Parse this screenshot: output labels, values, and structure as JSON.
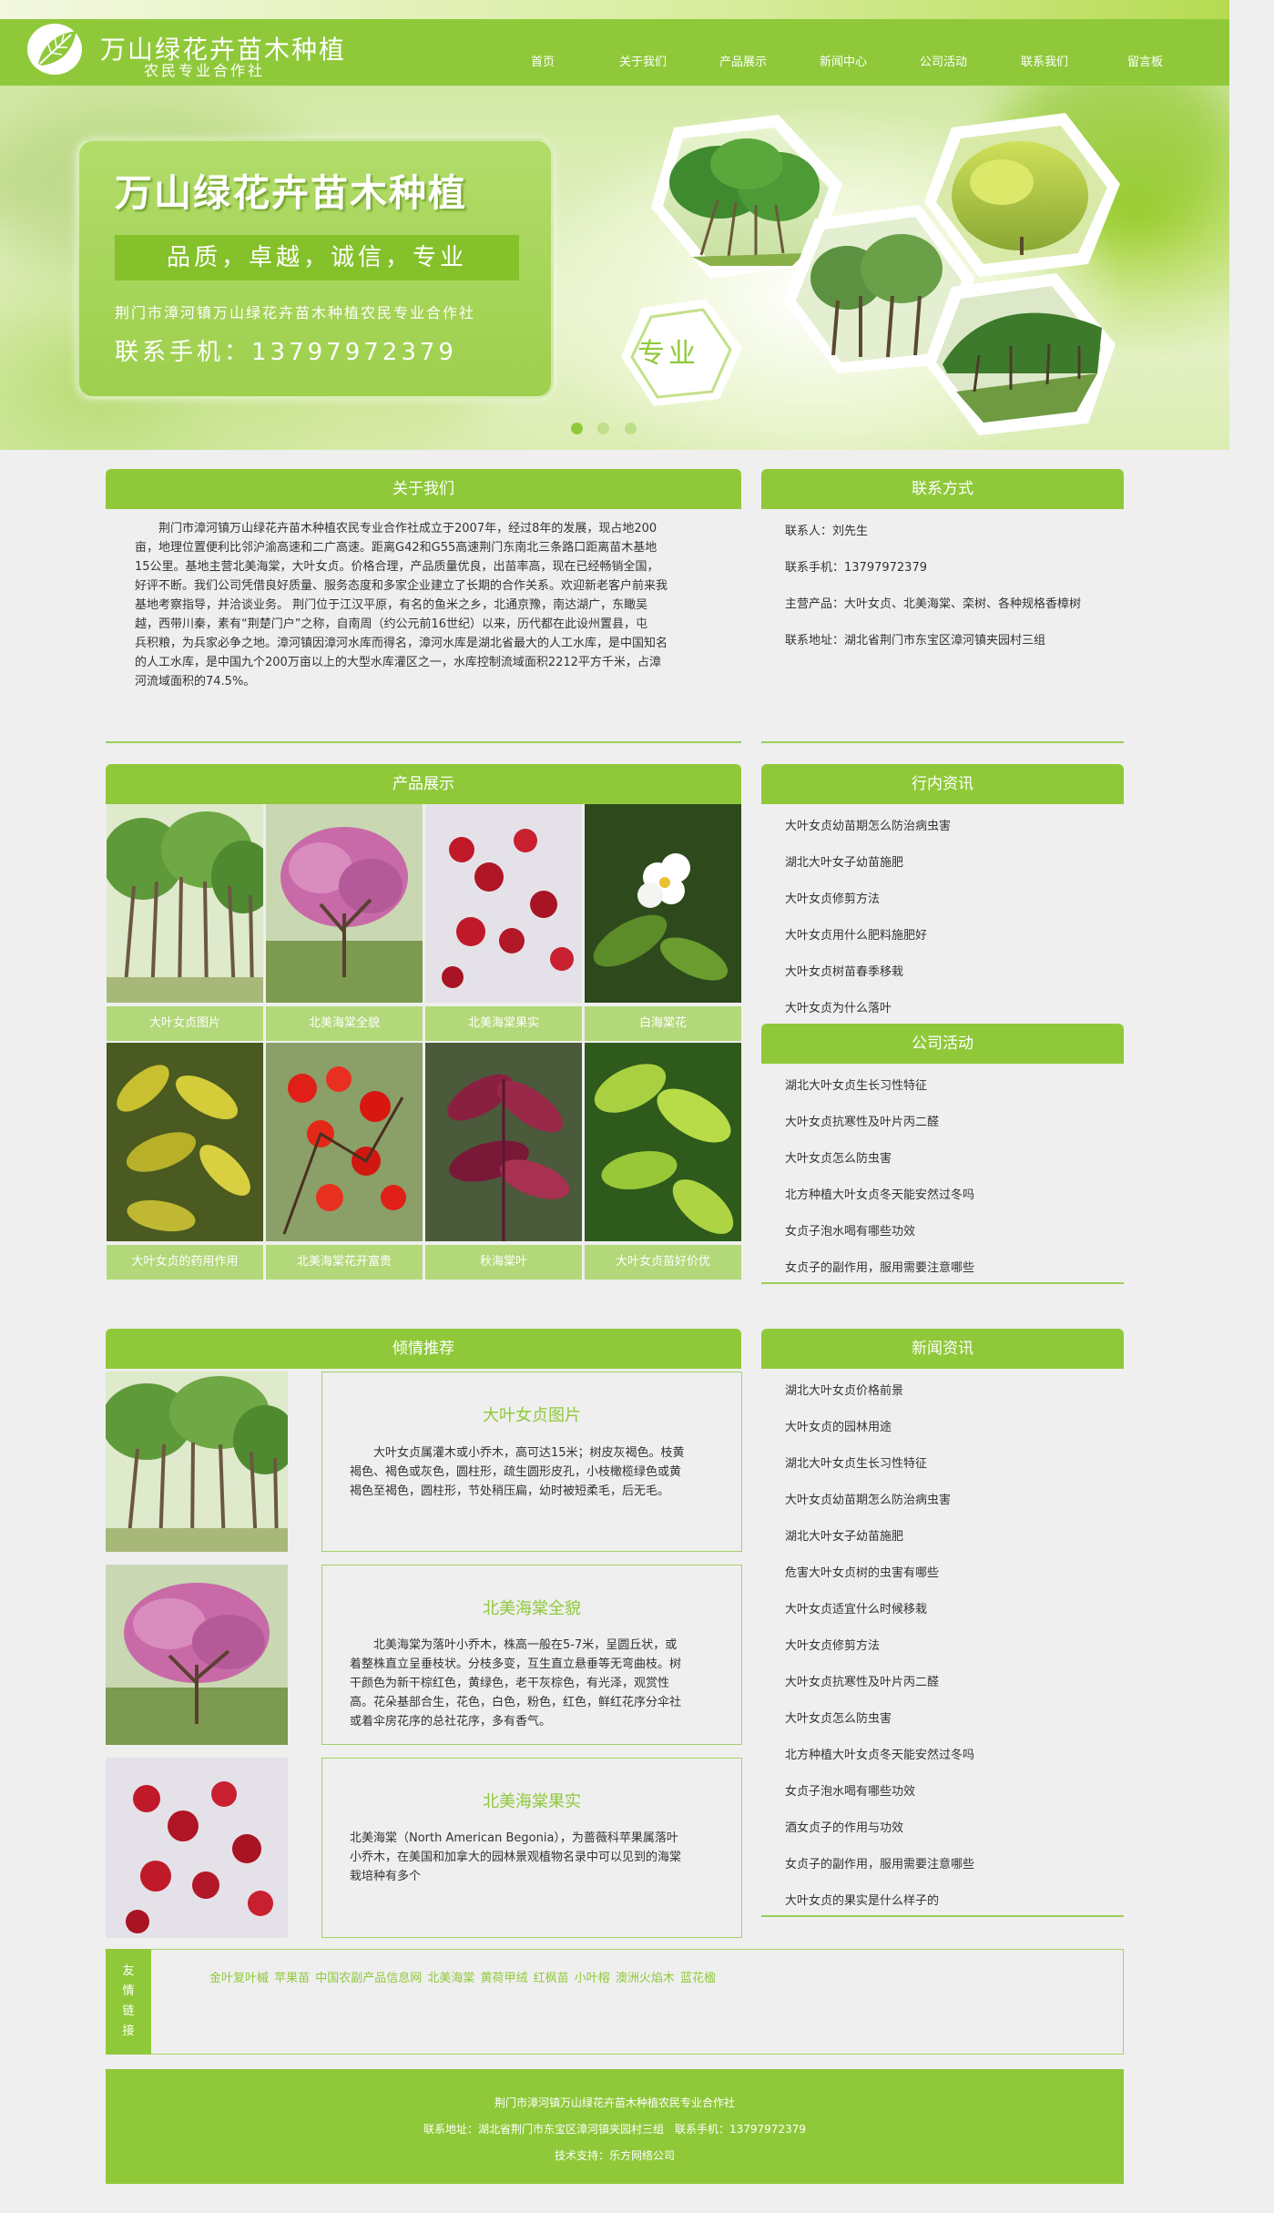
{
  "header": {
    "title": "万山绿花卉苗木种植",
    "subtitle": "农民专业合作社",
    "nav": [
      "首页",
      "关于我们",
      "产品展示",
      "新闻中心",
      "公司活动",
      "联系我们",
      "留言板"
    ]
  },
  "banner": {
    "title": "万山绿花卉苗木种植",
    "slogan": "品质，卓越，诚信，专业",
    "company": "荆门市漳河镇万山绿花卉苗木种植农民专业合作社",
    "phone": "联系手机：13797972379",
    "hex_label": "专业",
    "slide_count": 3,
    "active_slide": 1
  },
  "about": {
    "heading": "关于我们",
    "lines": [
      "荆门市漳河镇万山绿花卉苗木种植农民专业合作社成立于2007年，经过8年的发展，现占地200",
      "亩，地理位置便利比邻沪渝高速和二广高速。距离G42和G55高速荆门东南北三条路口距离苗木基地",
      "15公里。基地主营北美海棠，大叶女贞。价格合理，产品质量优良，出苗率高，现在已经畅销全国，",
      "好评不断。我们公司凭借良好质量、服务态度和多家企业建立了长期的合作关系。欢迎新老客户前来我",
      "基地考察指导，并洽谈业务。 荆门位于江汉平原，有名的鱼米之乡，北通京豫，南达湖广，东瞰吴",
      "越，西带川秦，素有“荆楚门户”之称，自南周（约公元前16世纪）以来，历代都在此设州置县，屯",
      "兵积粮，为兵家必争之地。漳河镇因漳河水库而得名，漳河水库是湖北省最大的人工水库，是中国知名",
      "的人工水库，是中国九个200万亩以上的大型水库灌区之一，水库控制流域面积2212平方千米，占漳",
      "河流域面积的74.5%。"
    ]
  },
  "contact": {
    "heading": "联系方式",
    "items": [
      "联系人：刘先生",
      "联系手机：13797972379",
      "主营产品：大叶女贞、北美海棠、栾树、各种规格香樟树",
      "联系地址：湖北省荆门市东宝区漳河镇夹园村三组"
    ]
  },
  "products": {
    "heading": "产品展示",
    "items": [
      {
        "caption": "大叶女贞图片",
        "icon": "tree-grove-photo"
      },
      {
        "caption": "北美海棠全貌",
        "icon": "pink-blossom-tree-photo"
      },
      {
        "caption": "北美海棠果实",
        "icon": "red-berries-photo"
      },
      {
        "caption": "白海棠花",
        "icon": "white-flower-photo"
      },
      {
        "caption": "大叶女贞的药用作用",
        "icon": "yellow-leaves-photo"
      },
      {
        "caption": "北美海棠花开富贵",
        "icon": "red-flowers-photo"
      },
      {
        "caption": "秋海棠叶",
        "icon": "purple-leaves-photo"
      },
      {
        "caption": "大叶女贞苗好价优",
        "icon": "green-leaves-photo"
      }
    ]
  },
  "industry_news": {
    "heading": "行内资讯",
    "items": [
      "大叶女贞幼苗期怎么防治病虫害",
      "湖北大叶女子幼苗施肥",
      "大叶女贞修剪方法",
      "大叶女贞用什么肥料施肥好",
      "大叶女贞树苗春季移栽",
      "大叶女贞为什么落叶"
    ]
  },
  "activities": {
    "heading": "公司活动",
    "items": [
      "湖北大叶女贞生长习性特征",
      "大叶女贞抗寒性及叶片丙二醛",
      "大叶女贞怎么防虫害",
      "北方种植大叶女贞冬天能安然过冬吗",
      "女贞子泡水喝有哪些功效",
      "女贞子的副作用，服用需要注意哪些"
    ]
  },
  "recommend": {
    "heading": "倾情推荐",
    "items": [
      {
        "title": "大叶女贞图片",
        "icon": "tree-grove-photo",
        "desc": [
          "　　大叶女贞属灌木或小乔木，高可达15米；树皮灰褐色。枝黄",
          "褐色、褐色或灰色，圆柱形，疏生圆形皮孔，小枝橄榄绿色或黄",
          "褐色至褐色，圆柱形，节处稍压扁，幼时被短柔毛，后无毛。"
        ]
      },
      {
        "title": "北美海棠全貌",
        "icon": "pink-blossom-tree-photo",
        "desc": [
          "　　北美海棠为落叶小乔木，株高一般在5-7米，呈圆丘状，或",
          "着整株直立呈垂枝状。分枝多变，互生直立悬垂等无弯曲枝。树",
          "干颜色为新干棕红色，黄绿色，老干灰棕色，有光泽，观赏性",
          "高。花朵基部合生，花色，白色，粉色，红色，鲜红花序分伞社",
          "或着伞房花序的总社花序，多有香气。"
        ]
      },
      {
        "title": "北美海棠果实",
        "icon": "red-berries-photo",
        "desc": [
          "北美海棠（North American Begonia），为蔷薇科苹果属落叶",
          "小乔木，在美国和加拿大的园林景观植物名录中可以见到的海棠",
          "栽培种有多个"
        ]
      }
    ]
  },
  "news": {
    "heading": "新闻资讯",
    "items": [
      "湖北大叶女贞价格前景",
      "大叶女贞的园林用途",
      "湖北大叶女贞生长习性特征",
      "大叶女贞幼苗期怎么防治病虫害",
      "湖北大叶女子幼苗施肥",
      "危害大叶女贞树的虫害有哪些",
      "大叶女贞适宜什么时候移栽",
      "大叶女贞修剪方法",
      "大叶女贞抗寒性及叶片丙二醛",
      "大叶女贞怎么防虫害",
      "北方种植大叶女贞冬天能安然过冬吗",
      "女贞子泡水喝有哪些功效",
      "酒女贞子的作用与功效",
      "女贞子的副作用，服用需要注意哪些",
      "大叶女贞的果实是什么样子的"
    ]
  },
  "links": {
    "label": [
      "友",
      "情",
      "链",
      "接"
    ],
    "text": "金叶复叶槭 苹果苗 中国农副产品信息网 北美海棠 黄荷甲绒 红枫苗 小叶榕 澳洲火焰木 蓝花楹"
  },
  "footer": {
    "company": "荆门市漳河镇万山绿花卉苗木种植农民专业合作社",
    "contact": "联系地址：湖北省荆门市东宝区漳河镇夹园村三组　联系手机：13797972379",
    "support": "技术支持：乐方网络公司"
  },
  "colors": {
    "brand_green": "#8fc93a",
    "caption_green": "#b3d87a",
    "link_green": "#8fc93a"
  }
}
